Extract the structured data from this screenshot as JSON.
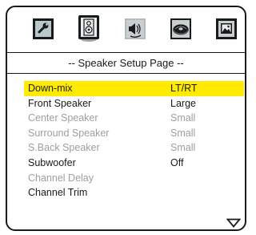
{
  "tabs": [
    {
      "icon": "wrench-settings-icon"
    },
    {
      "icon": "speaker-icon",
      "selected": true
    },
    {
      "icon": "audio-sound-icon"
    },
    {
      "icon": "disc-icon"
    },
    {
      "icon": "picture-icon"
    }
  ],
  "page_title": "-- Speaker Setup Page --",
  "menu": [
    {
      "label": "Down-mix",
      "value": "LT/RT",
      "state": "selected"
    },
    {
      "label": "Front Speaker",
      "value": "Large",
      "state": "enabled"
    },
    {
      "label": "Center Speaker",
      "value": "Small",
      "state": "disabled"
    },
    {
      "label": "Surround Speaker",
      "value": "Small",
      "state": "disabled"
    },
    {
      "label": "S.Back Speaker",
      "value": "Small",
      "state": "disabled"
    },
    {
      "label": "Subwoofer",
      "value": "Off",
      "state": "enabled"
    },
    {
      "label": "Channel Delay",
      "value": "",
      "state": "disabled"
    },
    {
      "label": "Channel Trim",
      "value": "",
      "state": "enabled"
    }
  ],
  "scroll_indicator": "down-triangle-icon",
  "colors": {
    "highlight": "#ffea00",
    "text": "#1a1a1a",
    "disabled_text": "#9e9e9e",
    "tab_fill": "#b8c8cc"
  }
}
